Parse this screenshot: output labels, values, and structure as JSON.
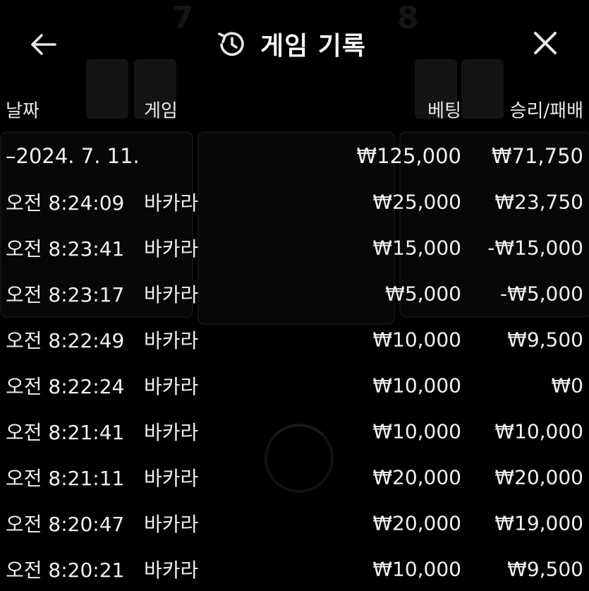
{
  "header": {
    "title": "게임 기록",
    "back_icon": "arrow-left-icon",
    "history_icon": "history-icon",
    "close_icon": "close-icon"
  },
  "columns": {
    "date": "날짜",
    "game": "게임",
    "bet": "베팅",
    "result": "승리/패배"
  },
  "summary": {
    "date": "–2024. 7. 11.",
    "bet": "₩125,000",
    "result": "₩71,750"
  },
  "rows": [
    {
      "time": "오전 8:24:09",
      "game": "바카라",
      "bet": "₩25,000",
      "result": "₩23,750"
    },
    {
      "time": "오전 8:23:41",
      "game": "바카라",
      "bet": "₩15,000",
      "result": "-₩15,000"
    },
    {
      "time": "오전 8:23:17",
      "game": "바카라",
      "bet": "₩5,000",
      "result": "-₩5,000"
    },
    {
      "time": "오전 8:22:49",
      "game": "바카라",
      "bet": "₩10,000",
      "result": "₩9,500"
    },
    {
      "time": "오전 8:22:24",
      "game": "바카라",
      "bet": "₩10,000",
      "result": "₩0"
    },
    {
      "time": "오전 8:21:41",
      "game": "바카라",
      "bet": "₩10,000",
      "result": "₩10,000"
    },
    {
      "time": "오전 8:21:11",
      "game": "바카라",
      "bet": "₩20,000",
      "result": "₩20,000"
    },
    {
      "time": "오전 8:20:47",
      "game": "바카라",
      "bet": "₩20,000",
      "result": "₩19,000"
    },
    {
      "time": "오전 8:20:21",
      "game": "바카라",
      "bet": "₩10,000",
      "result": "₩9,500"
    }
  ],
  "colors": {
    "background": "#000000",
    "text": "#f0f0f0"
  }
}
